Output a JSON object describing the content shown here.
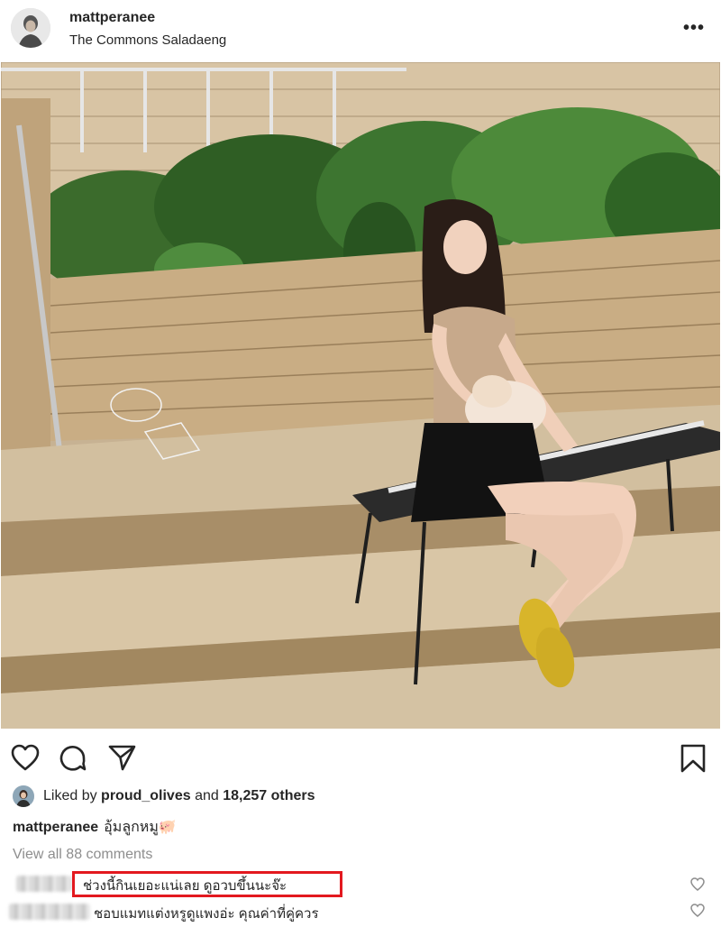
{
  "header": {
    "username": "mattperanee",
    "location": "The Commons Saladaeng",
    "more_glyph": "•••"
  },
  "actions": {
    "like_icon": "heart-icon",
    "comment_icon": "comment-icon",
    "share_icon": "share-icon",
    "save_icon": "bookmark-icon"
  },
  "likes": {
    "prefix": "Liked by ",
    "liker": "proud_olives",
    "middle": " and ",
    "others": "18,257 others"
  },
  "caption": {
    "username": "mattperanee",
    "text": "อุ้มลูกหมู🐖"
  },
  "view_all_comments": "View all 88 comments",
  "comments": [
    {
      "text": "ช่วงนี้กินเยอะแน่เลย ดูอวบขึ้นนะจ๊ะ",
      "highlighted": true
    },
    {
      "text": "ชอบแมทแต่งหรูดูแพงอ่ะ คุณค่าที่คู่ควร",
      "highlighted": false
    }
  ],
  "colors": {
    "text": "#262626",
    "muted": "#8e8e8e",
    "highlight_border": "#e3191f"
  }
}
